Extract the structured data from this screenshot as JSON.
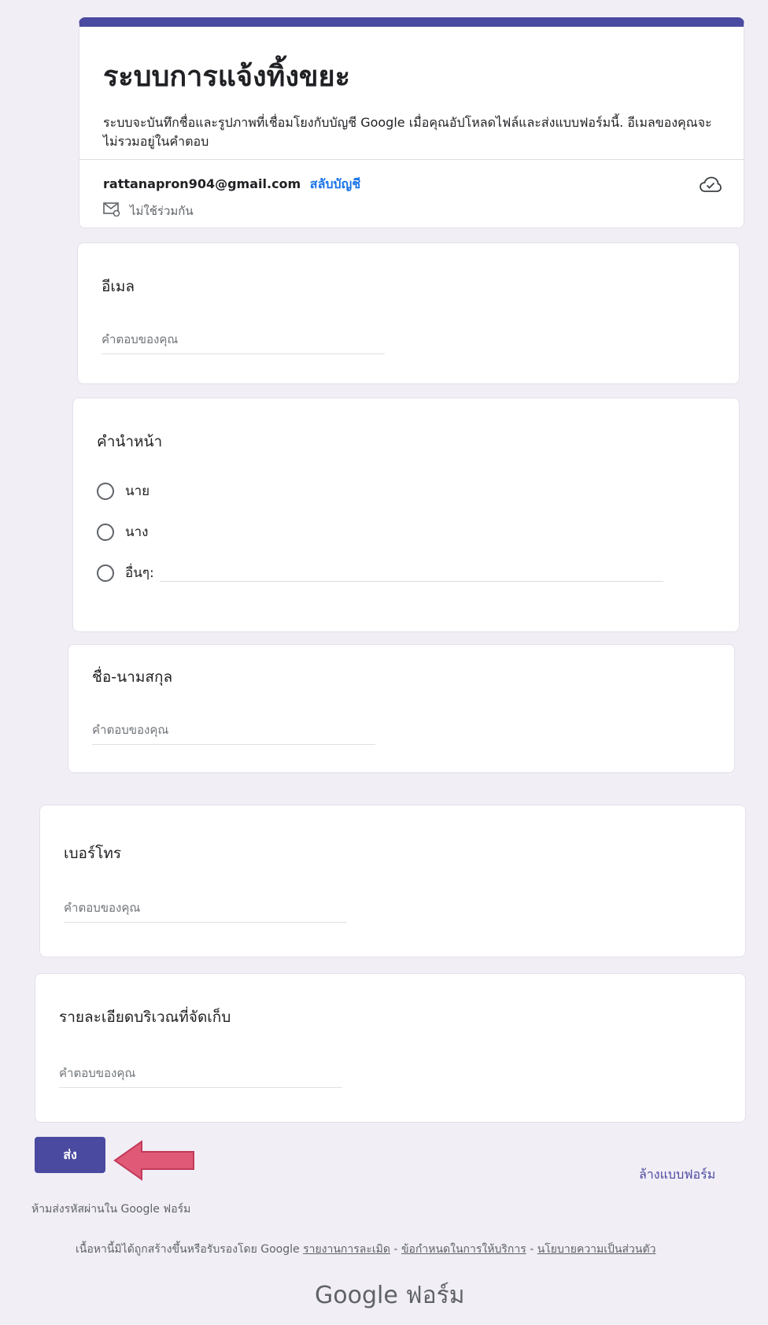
{
  "form": {
    "title": "ระบบการแจ้งทิ้งขยะ",
    "description": "ระบบจะบันทึกชื่อและรูปภาพที่เชื่อมโยงกับบัญชี Google เมื่อคุณอัปโหลดไฟล์และส่งแบบฟอร์มนี้. อีเมลของคุณจะไม่รวมอยู่ในคำตอบ",
    "account_email": "rattanapron904@gmail.com",
    "switch_account": "สลับบัญชี",
    "not_shared": "ไม่ใช้ร่วมกัน"
  },
  "questions": {
    "email": {
      "title": "อีเมล",
      "placeholder": "คำตอบของคุณ"
    },
    "prefix": {
      "title": "คำนำหน้า",
      "options": [
        "นาย",
        "นาง",
        "อื่นๆ:"
      ]
    },
    "fullname": {
      "title": "ชื่อ-นามสกุล",
      "placeholder": "คำตอบของคุณ"
    },
    "phone": {
      "title": "เบอร์โทร",
      "placeholder": "คำตอบของคุณ"
    },
    "location": {
      "title": "รายละเอียดบริเวณที่จัดเก็บ",
      "placeholder": "คำตอบของคุณ"
    }
  },
  "actions": {
    "submit": "ส่ง",
    "clear": "ล้างแบบฟอร์ม"
  },
  "footer": {
    "no_password": "ห้ามส่งรหัสผ่านใน Google ฟอร์ม",
    "disclaimer": "เนื้อหานี้มิได้ถูกสร้างขึ้นหรือรับรองโดย Google",
    "report_abuse": "รายงานการละเมิด",
    "terms": "ข้อกำหนดในการให้บริการ",
    "privacy": "นโยบายความเป็นส่วนตัว",
    "separator": " - ",
    "brand": "Google ฟอร์ม"
  },
  "colors": {
    "accent": "#4a4aa1",
    "link": "#1a73e8",
    "arrow": "#e05a78"
  }
}
